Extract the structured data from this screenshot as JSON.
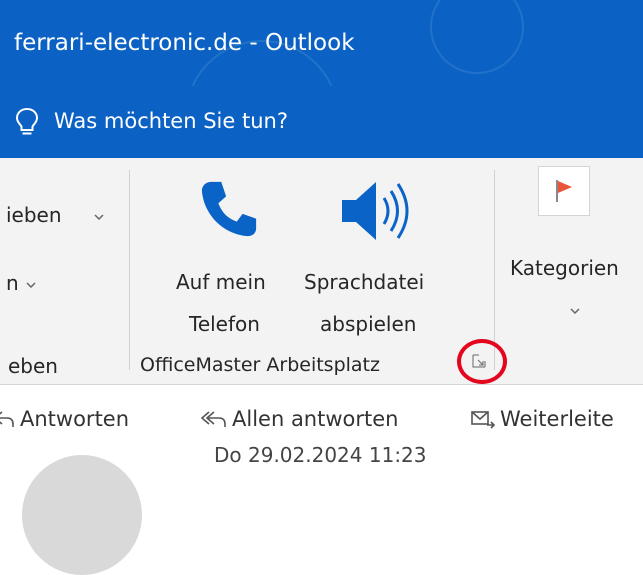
{
  "window": {
    "title": "ferrari-electronic.de  -  Outlook"
  },
  "tell_me": {
    "label": "Was möchten Sie tun?"
  },
  "ribbon": {
    "left_group": {
      "item1_label": "ieben",
      "item2_label": "n",
      "group_label": "eben"
    },
    "officemaster": {
      "call_label_line1": "Auf mein",
      "call_label_line2": "Telefon",
      "play_label_line1": "Sprachdatei",
      "play_label_line2": "abspielen",
      "group_label": "OfficeMaster Arbeitsplatz"
    },
    "tags": {
      "categorize_label": "Kategorien"
    }
  },
  "reading": {
    "reply_label": "Antworten",
    "reply_all_label": "Allen antworten",
    "forward_label": "Weiterleite",
    "date": "Do 29.02.2024 11:23"
  },
  "colors": {
    "accent": "#0b62c4",
    "highlight": "#e3061e",
    "icon_blue": "#0a64c8"
  }
}
